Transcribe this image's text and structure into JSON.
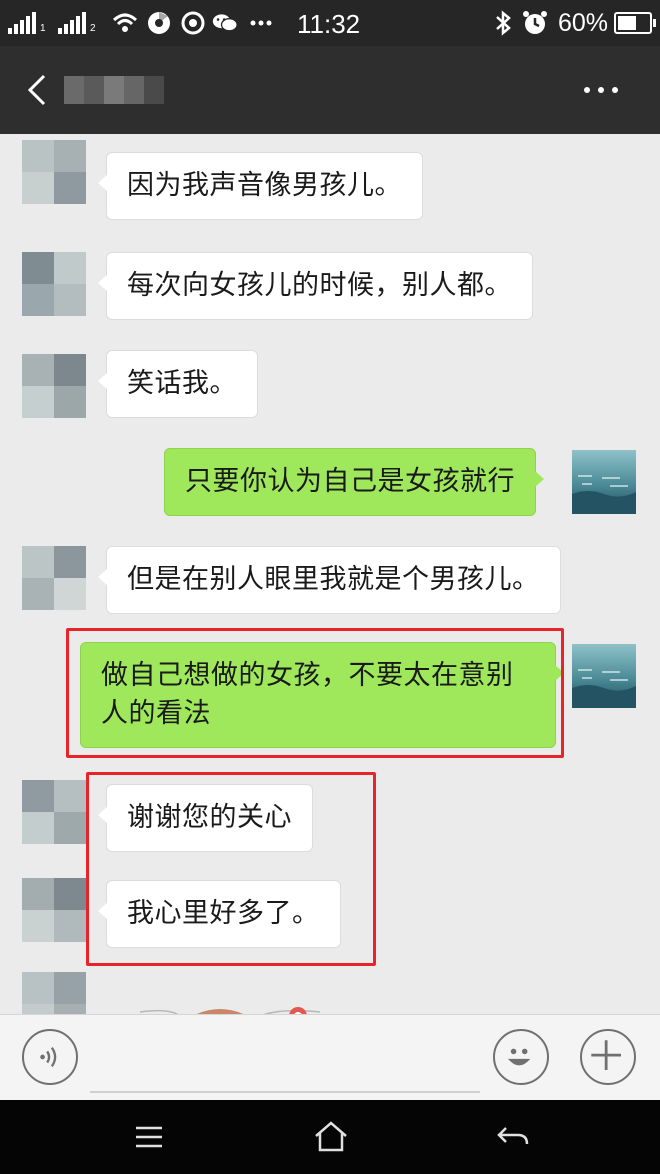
{
  "status_bar": {
    "sim1_label": "1",
    "sim2_label": "2",
    "time": "11:32",
    "battery_percent": "60%",
    "battery_level": 0.6,
    "icons": [
      "signal-icon",
      "wifi-icon",
      "media-icon",
      "location-icon",
      "wechat-icon",
      "more-notifications-icon",
      "bluetooth-icon",
      "alarm-icon",
      "battery-icon"
    ]
  },
  "title_bar": {
    "back_icon": "chevron-left-icon",
    "contact_name_blurred": true,
    "more_icon": "more-dots-icon"
  },
  "messages": [
    {
      "side": "in",
      "text": "因为我声音像男孩儿。"
    },
    {
      "side": "in",
      "text": "每次向女孩儿的时候，别人都。"
    },
    {
      "side": "in",
      "text": "笑话我。"
    },
    {
      "side": "out",
      "text": "只要你认为自己是女孩就行"
    },
    {
      "side": "in",
      "text": "但是在别人眼里我就是个男孩儿。"
    },
    {
      "side": "out",
      "text": "做自己想做的女孩，不要太在意别人的看法"
    },
    {
      "side": "in",
      "text": "谢谢您的关心"
    },
    {
      "side": "in",
      "text": "我心里好多了。"
    },
    {
      "side": "in",
      "type": "sticker"
    }
  ],
  "highlight_color": "#e8242a",
  "input_bar": {
    "voice_icon": "voice-icon",
    "emoji_icon": "emoji-icon",
    "plus_icon": "plus-icon",
    "input_value": ""
  },
  "nav_bar": {
    "icons": [
      "menu-icon",
      "home-icon",
      "back-icon"
    ]
  },
  "colors": {
    "outgoing_bubble": "#9fe75b",
    "incoming_bubble": "#ffffff",
    "title_bar": "#2e2e2e",
    "chat_background": "#ebebeb"
  }
}
